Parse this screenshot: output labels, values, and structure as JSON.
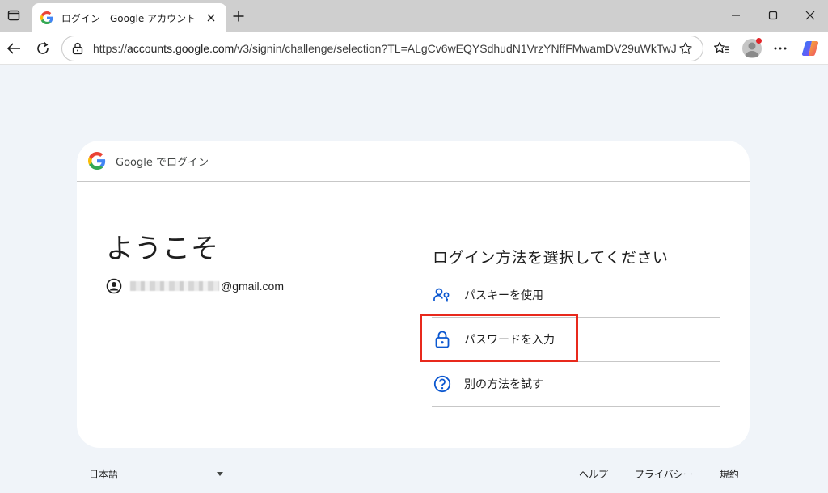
{
  "browser": {
    "tab_title": "ログイン - Google アカウント",
    "url_scheme": "https://",
    "url_domain": "accounts.google.com",
    "url_path": "/v3/signin/challenge/selection?TL=ALgCv6wEQYSdhudN1VrzYNffFMwamDV29uWkTwJ..."
  },
  "card": {
    "header_text": "Google でログイン",
    "welcome": "ようこそ",
    "account_domain": "@gmail.com",
    "choose_title": "ログイン方法を選択してください",
    "options": [
      {
        "label": "パスキーを使用",
        "icon": "passkey-icon"
      },
      {
        "label": "パスワードを入力",
        "icon": "lock-icon"
      },
      {
        "label": "別の方法を試す",
        "icon": "help-icon"
      }
    ]
  },
  "footer": {
    "language": "日本語",
    "links": [
      "ヘルプ",
      "プライバシー",
      "規約"
    ]
  },
  "colors": {
    "accent_blue": "#0b57d0",
    "highlight_red": "#e8291c",
    "page_bg": "#f0f4f9"
  }
}
